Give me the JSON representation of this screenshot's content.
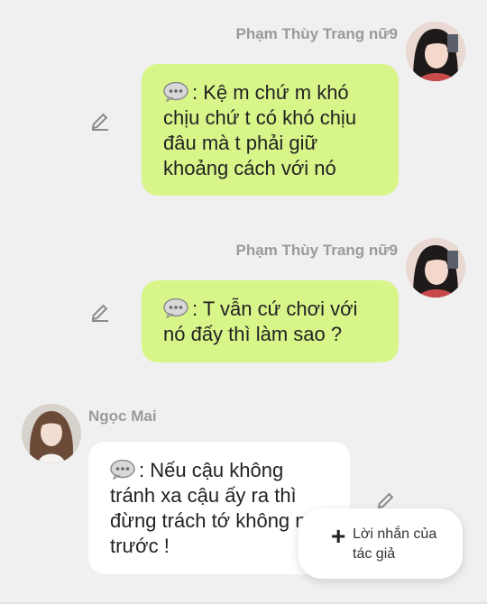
{
  "messages": [
    {
      "sender": "Phạm Thùy Trang nữ9",
      "text": ": Kệ m chứ m khó chịu chứ t có khó chịu đâu mà t phải giữ khoảng cách với nó",
      "side": "right",
      "bubble_color": "#d8f58a"
    },
    {
      "sender": "Phạm Thùy Trang nữ9",
      "text": ": T vẫn cứ chơi với nó đấy thì làm sao ?",
      "side": "right",
      "bubble_color": "#d8f58a"
    },
    {
      "sender": "Ngọc Mai",
      "text": ": Nếu cậu không tránh xa cậu ấy ra thì đừng trách tớ không nói trước !",
      "side": "left",
      "bubble_color": "#ffffff"
    }
  ],
  "fab": {
    "icon": "plus-icon",
    "label": "Lời nhắn của tác giả"
  },
  "icons": {
    "message": "chat-bubble-icon",
    "edit": "pencil-icon"
  }
}
